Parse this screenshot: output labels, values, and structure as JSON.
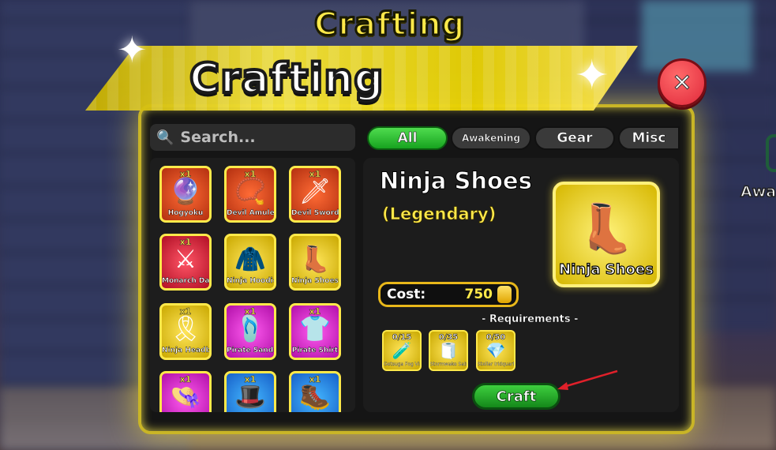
{
  "header": {
    "top_title": "Crafting",
    "banner_title": "Crafting"
  },
  "side": {
    "label": "Awa"
  },
  "search": {
    "placeholder": "Search..."
  },
  "tabs": [
    {
      "label": "All",
      "active": true
    },
    {
      "label": "Awakening",
      "active": false
    },
    {
      "label": "Gear",
      "active": false
    },
    {
      "label": "Misc",
      "active": false
    }
  ],
  "items": [
    {
      "name": "Hogyoku",
      "qty": "x1",
      "icon": "orb-icon"
    },
    {
      "name": "Devil Amulet",
      "qty": "x1",
      "icon": "amulet-icon"
    },
    {
      "name": "Devil Sword",
      "qty": "x1",
      "icon": "sword-icon"
    },
    {
      "name": "Monarch Daggers",
      "qty": "x1",
      "icon": "daggers-icon"
    },
    {
      "name": "Ninja Hoodie",
      "qty": "",
      "icon": "hoodie-icon"
    },
    {
      "name": "Ninja Shoes",
      "qty": "",
      "icon": "shoes-icon"
    },
    {
      "name": "Ninja Headband",
      "qty": "x1",
      "icon": "headband-icon"
    },
    {
      "name": "Pirate Sandals",
      "qty": "x1",
      "icon": "sandals-icon"
    },
    {
      "name": "Pirate Shirt",
      "qty": "x1",
      "icon": "shirt-icon"
    },
    {
      "name": "",
      "qty": "x1",
      "icon": "straw-hat-icon"
    },
    {
      "name": "",
      "qty": "x1",
      "icon": "hat-icon"
    },
    {
      "name": "",
      "qty": "x1",
      "icon": "boots-icon"
    }
  ],
  "detail": {
    "name": "Ninja Shoes",
    "rarity": "(Legendary)",
    "preview_caption": "Ninja Shoes",
    "cost_label": "Cost:",
    "cost_value": "750",
    "requirements_title": "- Requirements -",
    "requirements": [
      {
        "count": "0/15",
        "name": "Getsuga Fog Vial",
        "icon": "vial-icon"
      },
      {
        "count": "0/35",
        "name": "Stormwake Sabloth",
        "icon": "cloth-icon"
      },
      {
        "count": "0/50",
        "name": "Stellar Iridquartz",
        "icon": "crystal-icon"
      }
    ],
    "craft_label": "Craft"
  },
  "close": {
    "label": "✕"
  },
  "colors": {
    "accent": "#ffe94a",
    "panel_border": "#c9b526",
    "craft": "#2bb52b",
    "close": "#e0283a"
  }
}
